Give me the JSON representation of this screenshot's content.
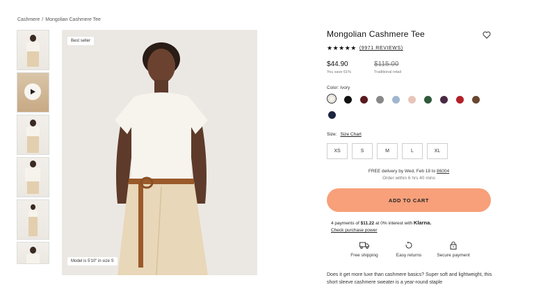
{
  "breadcrumb": {
    "parent": "Cashmere",
    "separator": "/",
    "current": "Mongolian Cashmere Tee"
  },
  "thumbnails": [
    "front view",
    "video",
    "side view",
    "front view 2",
    "full length",
    "detail"
  ],
  "main_image": {
    "badge_top": "Best seller",
    "badge_bottom": "Model is 5'10\" in size S"
  },
  "product": {
    "title": "Mongolian Cashmere Tee",
    "stars": "★★★★★",
    "reviews": "(9971 REVIEWS)",
    "price": "$44.90",
    "price_sub": "You save 61%",
    "compare_price": "$115.00",
    "compare_sub": "Traditional retail"
  },
  "color": {
    "label": "Color: Ivory",
    "swatches": [
      {
        "name": "Ivory",
        "hex": "#f6f2e4"
      },
      {
        "name": "Black",
        "hex": "#111111"
      },
      {
        "name": "Burgundy",
        "hex": "#5a1a1f"
      },
      {
        "name": "Grey",
        "hex": "#888888"
      },
      {
        "name": "Light Blue",
        "hex": "#9fb6cf"
      },
      {
        "name": "Blush",
        "hex": "#e8c5b8"
      },
      {
        "name": "Green",
        "hex": "#2f5a3c"
      },
      {
        "name": "Plum",
        "hex": "#4a2a42"
      },
      {
        "name": "Red",
        "hex": "#b3202a"
      },
      {
        "name": "Brown",
        "hex": "#6a4631"
      },
      {
        "name": "Navy",
        "hex": "#1d2440"
      }
    ]
  },
  "size": {
    "label": "Size:",
    "chart_link": "Size Chart",
    "options": [
      "XS",
      "S",
      "M",
      "L",
      "XL"
    ]
  },
  "delivery": {
    "line1_prefix": "FREE delivery by Wed, Feb 18 to",
    "zip": "86004",
    "line2": "Order within 6 hrs 40 mins"
  },
  "cart_button": "ADD TO CART",
  "klarna": {
    "prefix": "4 payments of",
    "amount": "$11.22",
    "suffix": "at 0% interest with",
    "brand": "Klarna.",
    "link": "Check purchase power"
  },
  "perks": [
    {
      "label": "Free shipping",
      "icon": "truck-icon"
    },
    {
      "label": "Easy returns",
      "icon": "return-icon"
    },
    {
      "label": "Secure payment",
      "icon": "lock-icon"
    }
  ],
  "description": "Does it get more luxe than cashmere basics? Super soft and lightweight, this short sleeve cashmere sweater is a year-round staple"
}
